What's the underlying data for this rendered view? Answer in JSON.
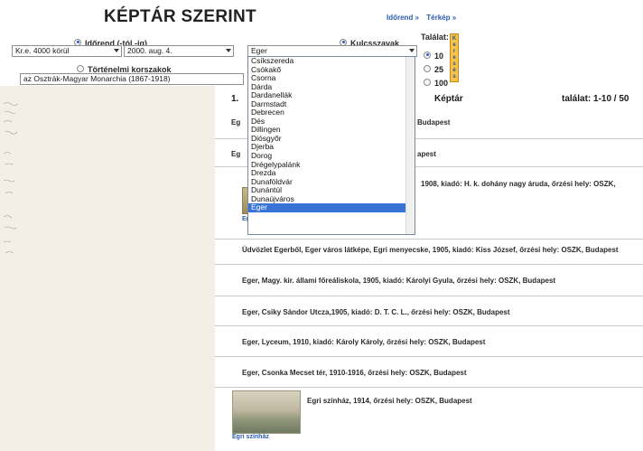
{
  "page_title": "KÉPTÁR SZERINT",
  "topnav": {
    "chronology": "Időrend »",
    "map": "Térkép »"
  },
  "filters": {
    "chronology_label": "Időrend (-tól -ig)",
    "from_value": "Kr.e. 4000 körül",
    "to_value": "2000. aug. 4.",
    "periods_label": "Történelmi korszakok",
    "period_value": "az Osztrák-Magyar Monarchia (1867-1918)",
    "keywords_label": "Kulcsszavak",
    "keyword_value": "Eger",
    "hits_label": "Találat:",
    "hits_options": [
      "10",
      "25",
      "100"
    ],
    "hits_selected": "10",
    "search_button": "Keresés"
  },
  "dropdown_options": [
    "Csíkszereda",
    "Csókakő",
    "Csorna",
    "Dárda",
    "Dardanellák",
    "Darmstadt",
    "Debrecen",
    "Dés",
    "Dillingen",
    "Diósgyőr",
    "Djerba",
    "Dorog",
    "Drégelypalánk",
    "Drezda",
    "Dunaföldvár",
    "Dunántúl",
    "Dunaújváros",
    "Eger"
  ],
  "dropdown_selected": "Eger",
  "results": {
    "header_left": "1.",
    "header_center": "Képtár",
    "header_right": "találat: 1-10 / 50",
    "partial": {
      "r1_prefix": "Eg",
      "r1_suffix": "Budapest",
      "r2_prefix": "Eg",
      "r2_suffix": "apest",
      "r3_text": "1908, kiadó: H. k. dohány nagy áruda, őrzési hely: OSZK,",
      "r3_thumb_caption": "Eg"
    },
    "items": [
      "Üdvözlet Egerből, Eger város látképe, Egri menyecske, 1905, kiadó: Kiss József, őrzési hely: OSZK, Budapest",
      "Eger, Magy. kir. állami főreáliskola, 1905, kiadó: Károlyi Gyula, őrzési hely: OSZK, Budapest",
      "Eger, Csiky Sándor Utcza,1905, kiadó: D. T. C. L., őrzési hely: OSZK, Budapest",
      "Eger, Lyceum, 1910, kiadó: Károly Károly, őrzési hely: OSZK, Budapest",
      "Eger, Csonka Mecset tér, 1910-1916, őrzési hely: OSZK, Budapest",
      "Egri színház, 1914, őrzési hely: OSZK, Budapest"
    ],
    "last_thumb_caption": "Egri színház"
  }
}
